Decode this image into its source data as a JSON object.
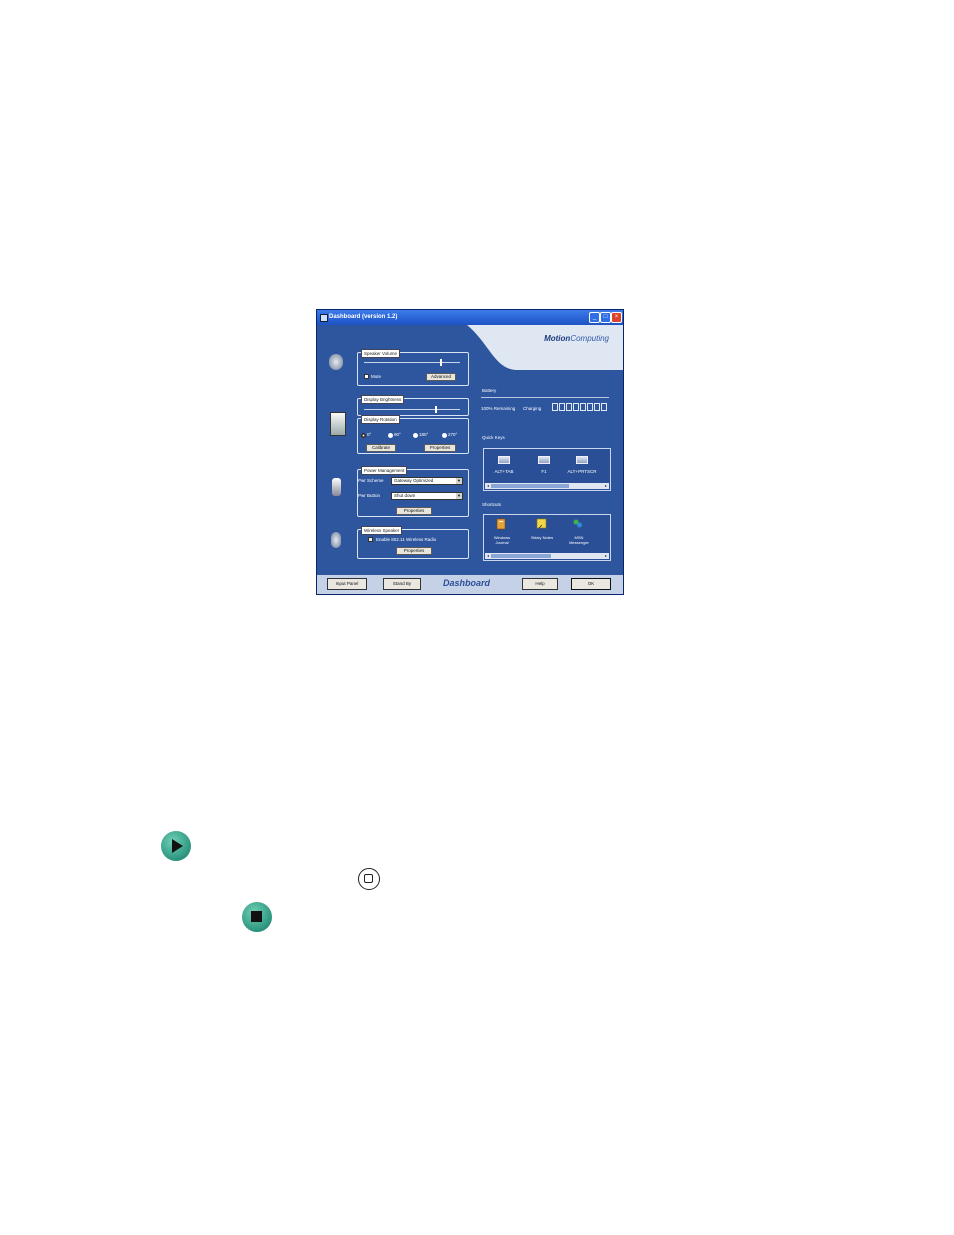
{
  "window": {
    "title": "Dashboard (version 1.2)",
    "brand_prefix": "Motion",
    "brand_suffix": "Computing"
  },
  "speaker_volume": {
    "legend": "Speaker Volume",
    "level": 0.8,
    "mute_label": "Mute",
    "advanced_button": "Advanced"
  },
  "display_brightness": {
    "legend": "Display Brightness",
    "level": 0.75
  },
  "display_rotation": {
    "legend": "Display Rotation",
    "options": [
      "0°",
      "90°",
      "180°",
      "270°"
    ],
    "calibrate_button": "Calibrate",
    "properties_button": "Properties"
  },
  "power_management": {
    "legend": "Power Management",
    "scheme_label": "Pwr Scheme",
    "scheme_value": "Gateway Optimized",
    "button_label": "Pwr Button",
    "button_value": "Shut down",
    "properties_button": "Properties"
  },
  "wireless_speaker": {
    "legend": "Wireless Speaker",
    "enable_label": "Enable 802.11 Wireless Radio",
    "properties_button": "Properties"
  },
  "battery": {
    "heading": "Battery",
    "remaining": "100% Remaining",
    "state": "Charging"
  },
  "quick_keys": {
    "heading": "Quick Keys",
    "items": [
      "ALT+TAB",
      "F1",
      "ALT+PRTSCR"
    ]
  },
  "shortcuts": {
    "heading": "Shortcuts",
    "items": [
      {
        "line1": "Windows",
        "line2": "Journal"
      },
      {
        "line1": "Sticky Notes",
        "line2": ""
      },
      {
        "line1": "MSN",
        "line2": "Messenger"
      }
    ]
  },
  "bottom_bar": {
    "input_panel": "Input Panel",
    "stand_by": "Stand By",
    "logo": "Dashboard",
    "help": "Help",
    "ok": "OK"
  }
}
